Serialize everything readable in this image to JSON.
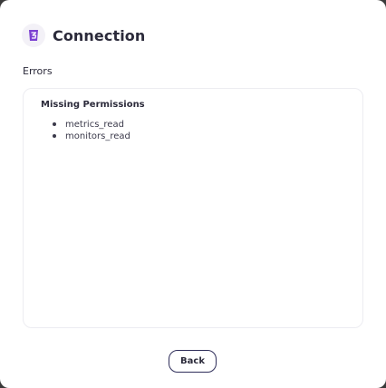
{
  "dialog": {
    "title": "Connection",
    "logo_icon": "integration-logo-icon",
    "logo_color": "#7b3fd1"
  },
  "errors": {
    "label": "Errors",
    "heading": "Missing Permissions",
    "items": [
      "metrics_read",
      "monitors_read"
    ]
  },
  "footer": {
    "back_label": "Back"
  }
}
